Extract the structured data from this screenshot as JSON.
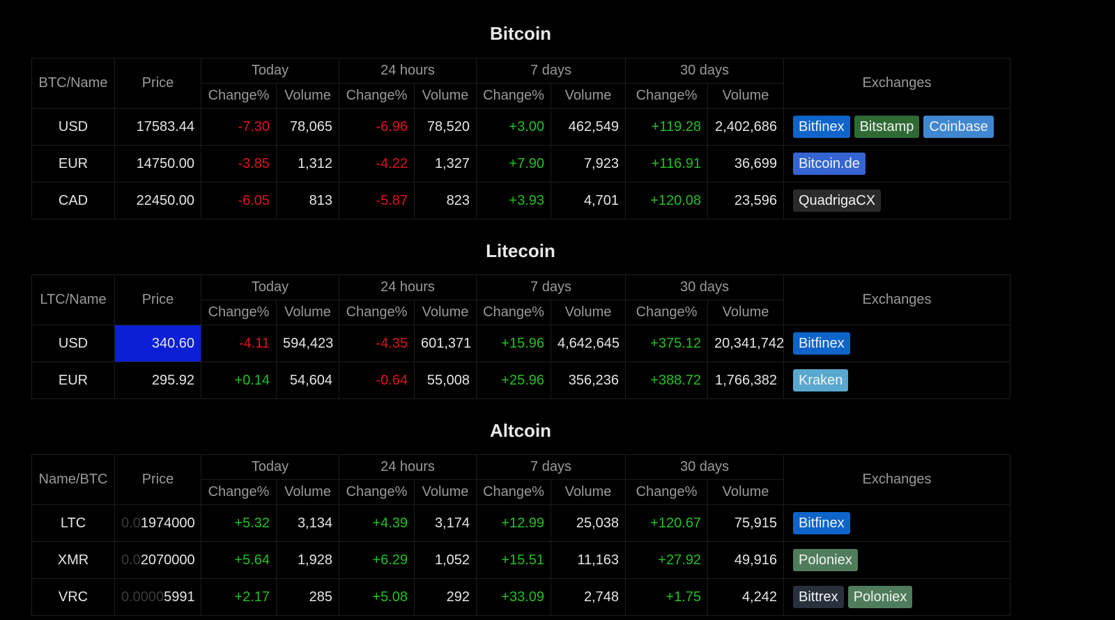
{
  "colors": {
    "Bitfinex": "#0e64c8",
    "Bitstamp": "#2f6a35",
    "Coinbase": "#3f87d0",
    "Bitcoin.de": "#3465d0",
    "QuadrigaCX": "#2a2a2a",
    "Kraken": "#58a8d0",
    "Poloniex": "#4f7d5c",
    "Bittrex": "#28303c"
  },
  "headers": {
    "price": "Price",
    "periods": [
      "Today",
      "24 hours",
      "7 days",
      "30 days"
    ],
    "change": "Change%",
    "volume": "Volume",
    "exchanges": "Exchanges"
  },
  "sections": [
    {
      "title": "Bitcoin",
      "name_header": "BTC/Name",
      "rows": [
        {
          "name": "USD",
          "price": "17583.44",
          "cells": [
            "-7.30",
            "78,065",
            "-6.96",
            "78,520",
            "+3.00",
            "462,549",
            "+119.28",
            "2,402,686"
          ],
          "exchanges": [
            "Bitfinex",
            "Bitstamp",
            "Coinbase"
          ]
        },
        {
          "name": "EUR",
          "price": "14750.00",
          "cells": [
            "-3.85",
            "1,312",
            "-4.22",
            "1,327",
            "+7.90",
            "7,923",
            "+116.91",
            "36,699"
          ],
          "exchanges": [
            "Bitcoin.de"
          ]
        },
        {
          "name": "CAD",
          "price": "22450.00",
          "cells": [
            "-6.05",
            "813",
            "-5.87",
            "823",
            "+3.93",
            "4,701",
            "+120.08",
            "23,596"
          ],
          "exchanges": [
            "QuadrigaCX"
          ]
        }
      ]
    },
    {
      "title": "Litecoin",
      "name_header": "LTC/Name",
      "rows": [
        {
          "name": "USD",
          "price": "340.60",
          "highlight": true,
          "cells": [
            "-4.11",
            "594,423",
            "-4.35",
            "601,371",
            "+15.96",
            "4,642,645",
            "+375.12",
            "20,341,742"
          ],
          "exchanges": [
            "Bitfinex"
          ]
        },
        {
          "name": "EUR",
          "price": "295.92",
          "cells": [
            "+0.14",
            "54,604",
            "-0.64",
            "55,008",
            "+25.96",
            "356,236",
            "+388.72",
            "1,766,382"
          ],
          "exchanges": [
            "Kraken"
          ]
        }
      ]
    },
    {
      "title": "Altcoin",
      "name_header": "Name/BTC",
      "rows": [
        {
          "name": "LTC",
          "price_prefix": "0.0",
          "price": "1974000",
          "cells": [
            "+5.32",
            "3,134",
            "+4.39",
            "3,174",
            "+12.99",
            "25,038",
            "+120.67",
            "75,915"
          ],
          "exchanges": [
            "Bitfinex"
          ]
        },
        {
          "name": "XMR",
          "price_prefix": "0.0",
          "price": "2070000",
          "cells": [
            "+5.64",
            "1,928",
            "+6.29",
            "1,052",
            "+15.51",
            "11,163",
            "+27.92",
            "49,916"
          ],
          "exchanges": [
            "Poloniex"
          ]
        },
        {
          "name": "VRC",
          "price_prefix": "0.0000",
          "price": "5991",
          "cells": [
            "+2.17",
            "285",
            "+5.08",
            "292",
            "+33.09",
            "2,748",
            "+1.75",
            "4,242"
          ],
          "exchanges": [
            "Bittrex",
            "Poloniex"
          ]
        }
      ]
    }
  ]
}
